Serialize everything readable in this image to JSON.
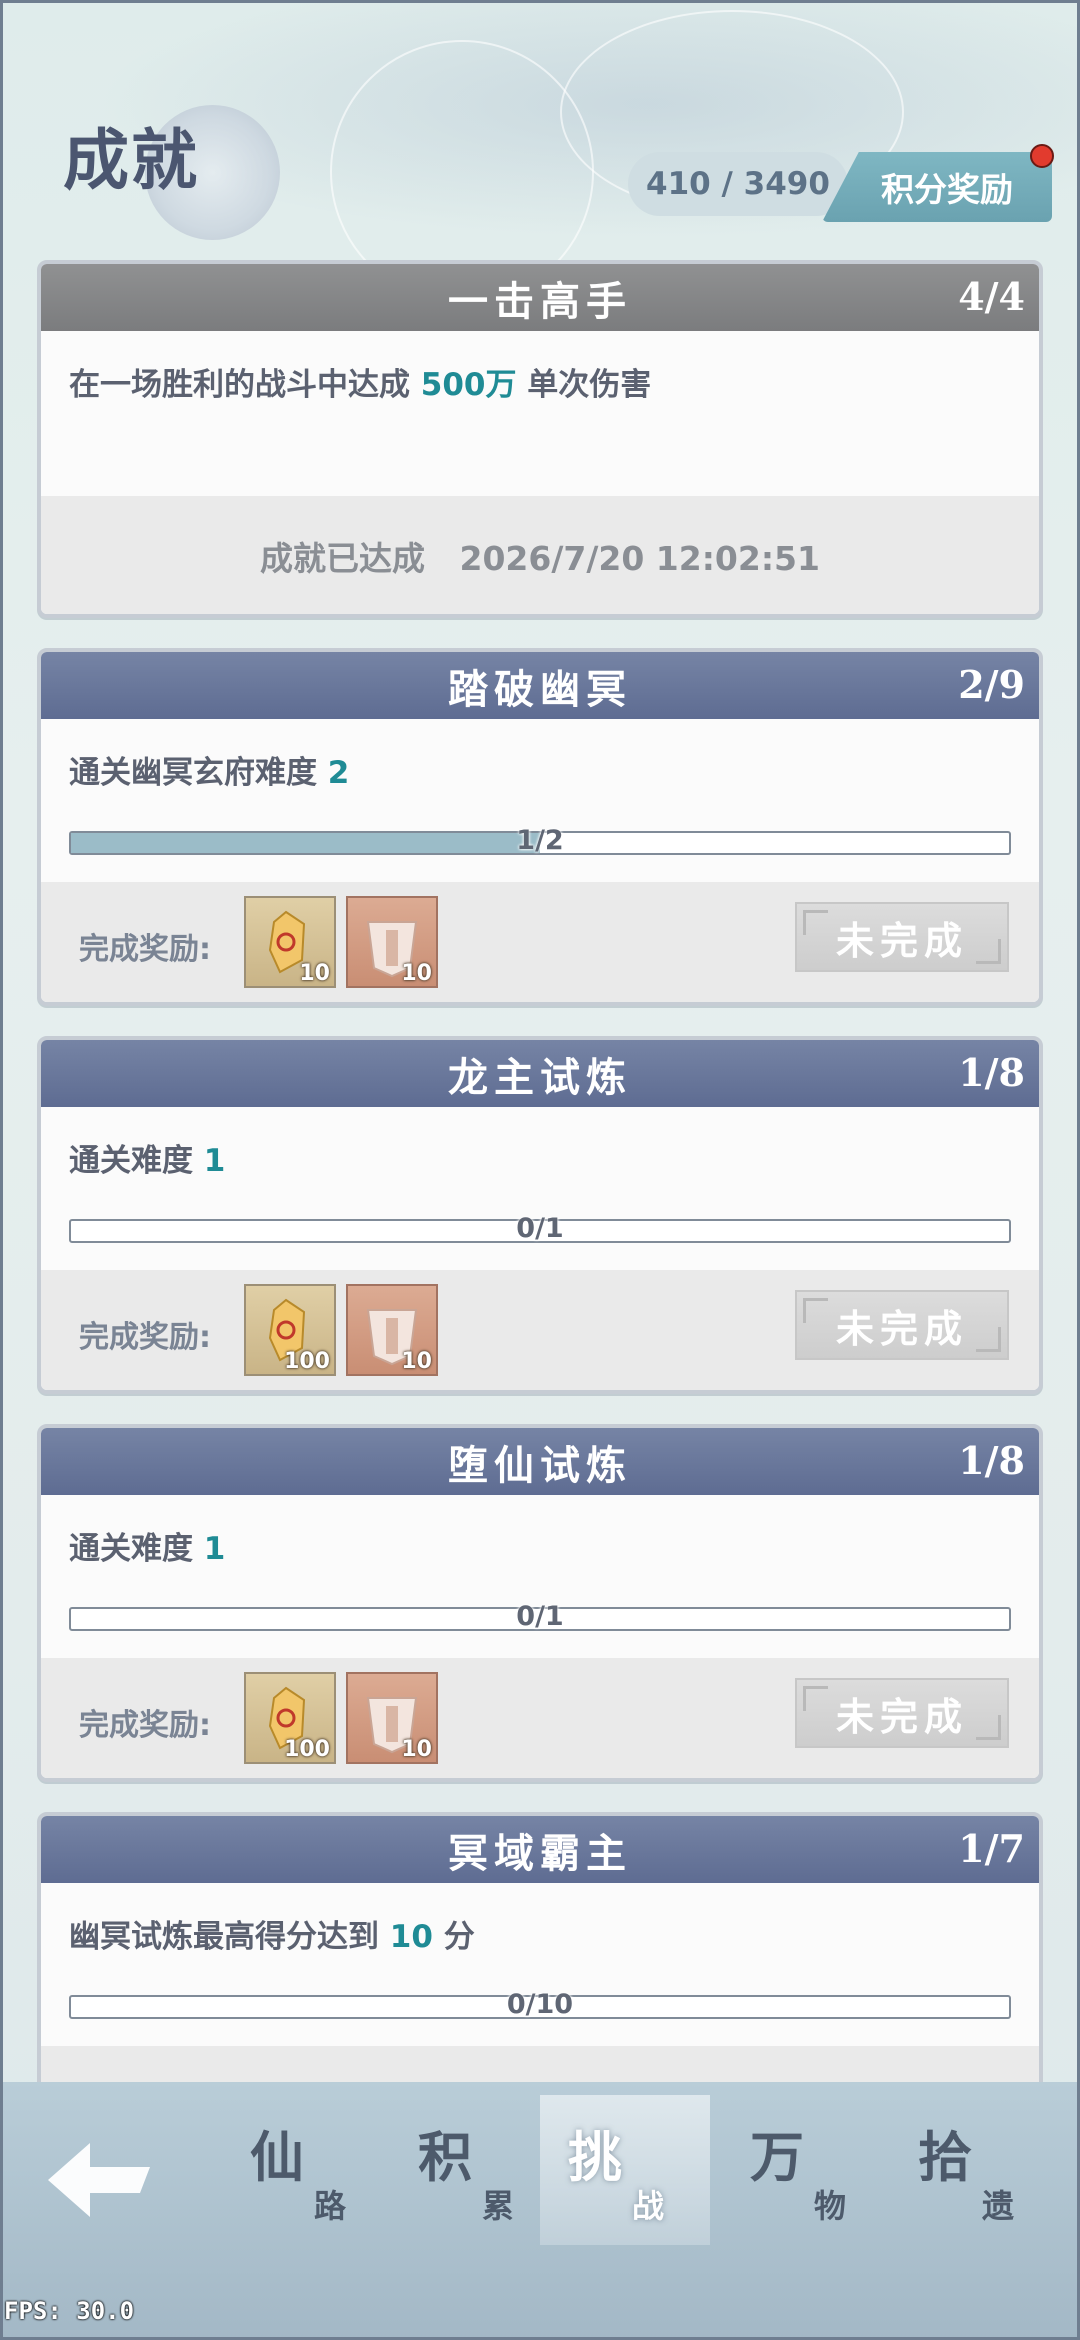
{
  "header": {
    "title": "成就",
    "score": "410 / 3490",
    "reward_button": "积分奖励"
  },
  "cards": [
    {
      "title": "一击高手",
      "count": "4/4",
      "desc_prefix": "在一场胜利的战斗中达成 ",
      "desc_highlight": "500万",
      "desc_suffix": " 单次伤害",
      "completed_text": "成就已达成   2026/7/20 12:02:51"
    },
    {
      "title": "踏破幽冥",
      "count": "2/9",
      "desc_prefix": "通关幽冥玄府难度 ",
      "desc_highlight": "2",
      "desc_suffix": "",
      "progress_label": "1/2",
      "progress_value": 0.5,
      "reward_label": "完成奖励:",
      "reward_items": [
        {
          "icon": "gold-crystal-icon",
          "qty": "10"
        },
        {
          "icon": "copper-chest-icon",
          "qty": "10"
        }
      ],
      "button": "未完成"
    },
    {
      "title": "龙主试炼",
      "count": "1/8",
      "desc_prefix": "通关难度 ",
      "desc_highlight": "1",
      "desc_suffix": "",
      "progress_label": "0/1",
      "progress_value": 0,
      "reward_label": "完成奖励:",
      "reward_items": [
        {
          "icon": "gold-crystal-icon",
          "qty": "100"
        },
        {
          "icon": "copper-chest-icon",
          "qty": "10"
        }
      ],
      "button": "未完成"
    },
    {
      "title": "堕仙试炼",
      "count": "1/8",
      "desc_prefix": "通关难度 ",
      "desc_highlight": "1",
      "desc_suffix": "",
      "progress_label": "0/1",
      "progress_value": 0,
      "reward_label": "完成奖励:",
      "reward_items": [
        {
          "icon": "gold-crystal-icon",
          "qty": "100"
        },
        {
          "icon": "copper-chest-icon",
          "qty": "10"
        }
      ],
      "button": "未完成"
    },
    {
      "title": "冥域霸主",
      "count": "1/7",
      "desc_prefix": "幽冥试炼最高得分达到 ",
      "desc_highlight": "10",
      "desc_suffix": " 分",
      "progress_label": "0/10",
      "progress_value": 0
    }
  ],
  "nav": {
    "back_icon": "back-arrow-icon",
    "tabs": [
      {
        "big": "仙",
        "small": "路"
      },
      {
        "big": "积",
        "small": "累"
      },
      {
        "big": "挑",
        "small": "战"
      },
      {
        "big": "万",
        "small": "物"
      },
      {
        "big": "拾",
        "small": "遗"
      }
    ],
    "active_index": 2
  },
  "fps": "FPS: 30.0",
  "colors": {
    "highlight": "#1f8b95",
    "accent": "#6aa2b0",
    "badge": "#e23b2e"
  }
}
